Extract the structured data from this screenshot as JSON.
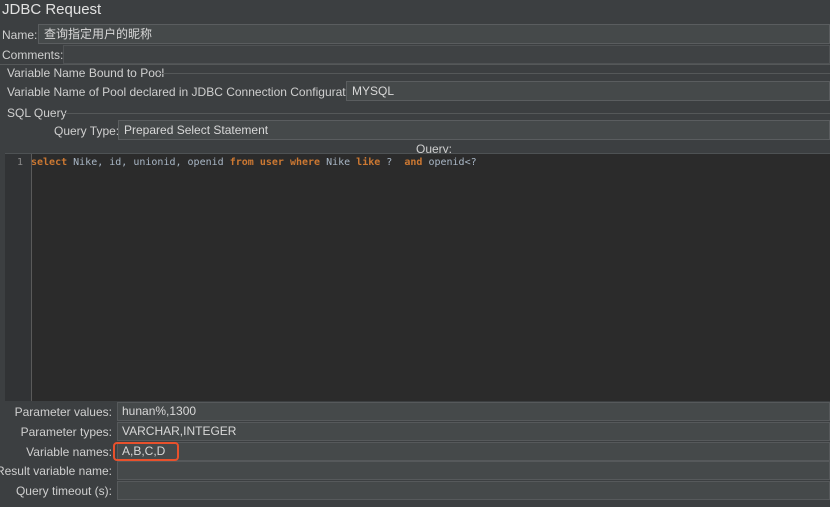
{
  "window": {
    "title": "JDBC Request"
  },
  "fields": {
    "name_label": "Name:",
    "name_value": "查询指定用户的昵称",
    "comments_label": "Comments:",
    "comments_value": ""
  },
  "pool_section": {
    "title": "Variable Name Bound to Pool",
    "pool_label": "Variable Name of Pool declared in JDBC Connection Configuration:",
    "pool_value": "MYSQL"
  },
  "sql_section": {
    "title": "SQL Query",
    "query_type_label": "Query Type:",
    "query_type_value": "Prepared Select Statement",
    "query_header": "Query:",
    "line_number": "1",
    "code": {
      "t1": "select",
      "t2": " Nike, id, unionid, openid ",
      "t3": "from",
      "t4": " ",
      "t5": "user",
      "t6": " ",
      "t7": "where",
      "t8": " Nike ",
      "t9": "like",
      "t10": " ?  ",
      "t11": "and",
      "t12": " openid<?"
    }
  },
  "parameters": {
    "values_label": "Parameter values:",
    "values_value": "hunan%,1300",
    "types_label": "Parameter types:",
    "types_value": "VARCHAR,INTEGER",
    "varnames_label": "Variable names:",
    "varnames_value": "A,B,C,D",
    "resultvar_label": "Result variable name:",
    "resultvar_value": "",
    "timeout_label": "Query timeout (s):",
    "timeout_value": ""
  },
  "colors": {
    "highlight": "#e8512c",
    "keyword": "#cc7832"
  }
}
